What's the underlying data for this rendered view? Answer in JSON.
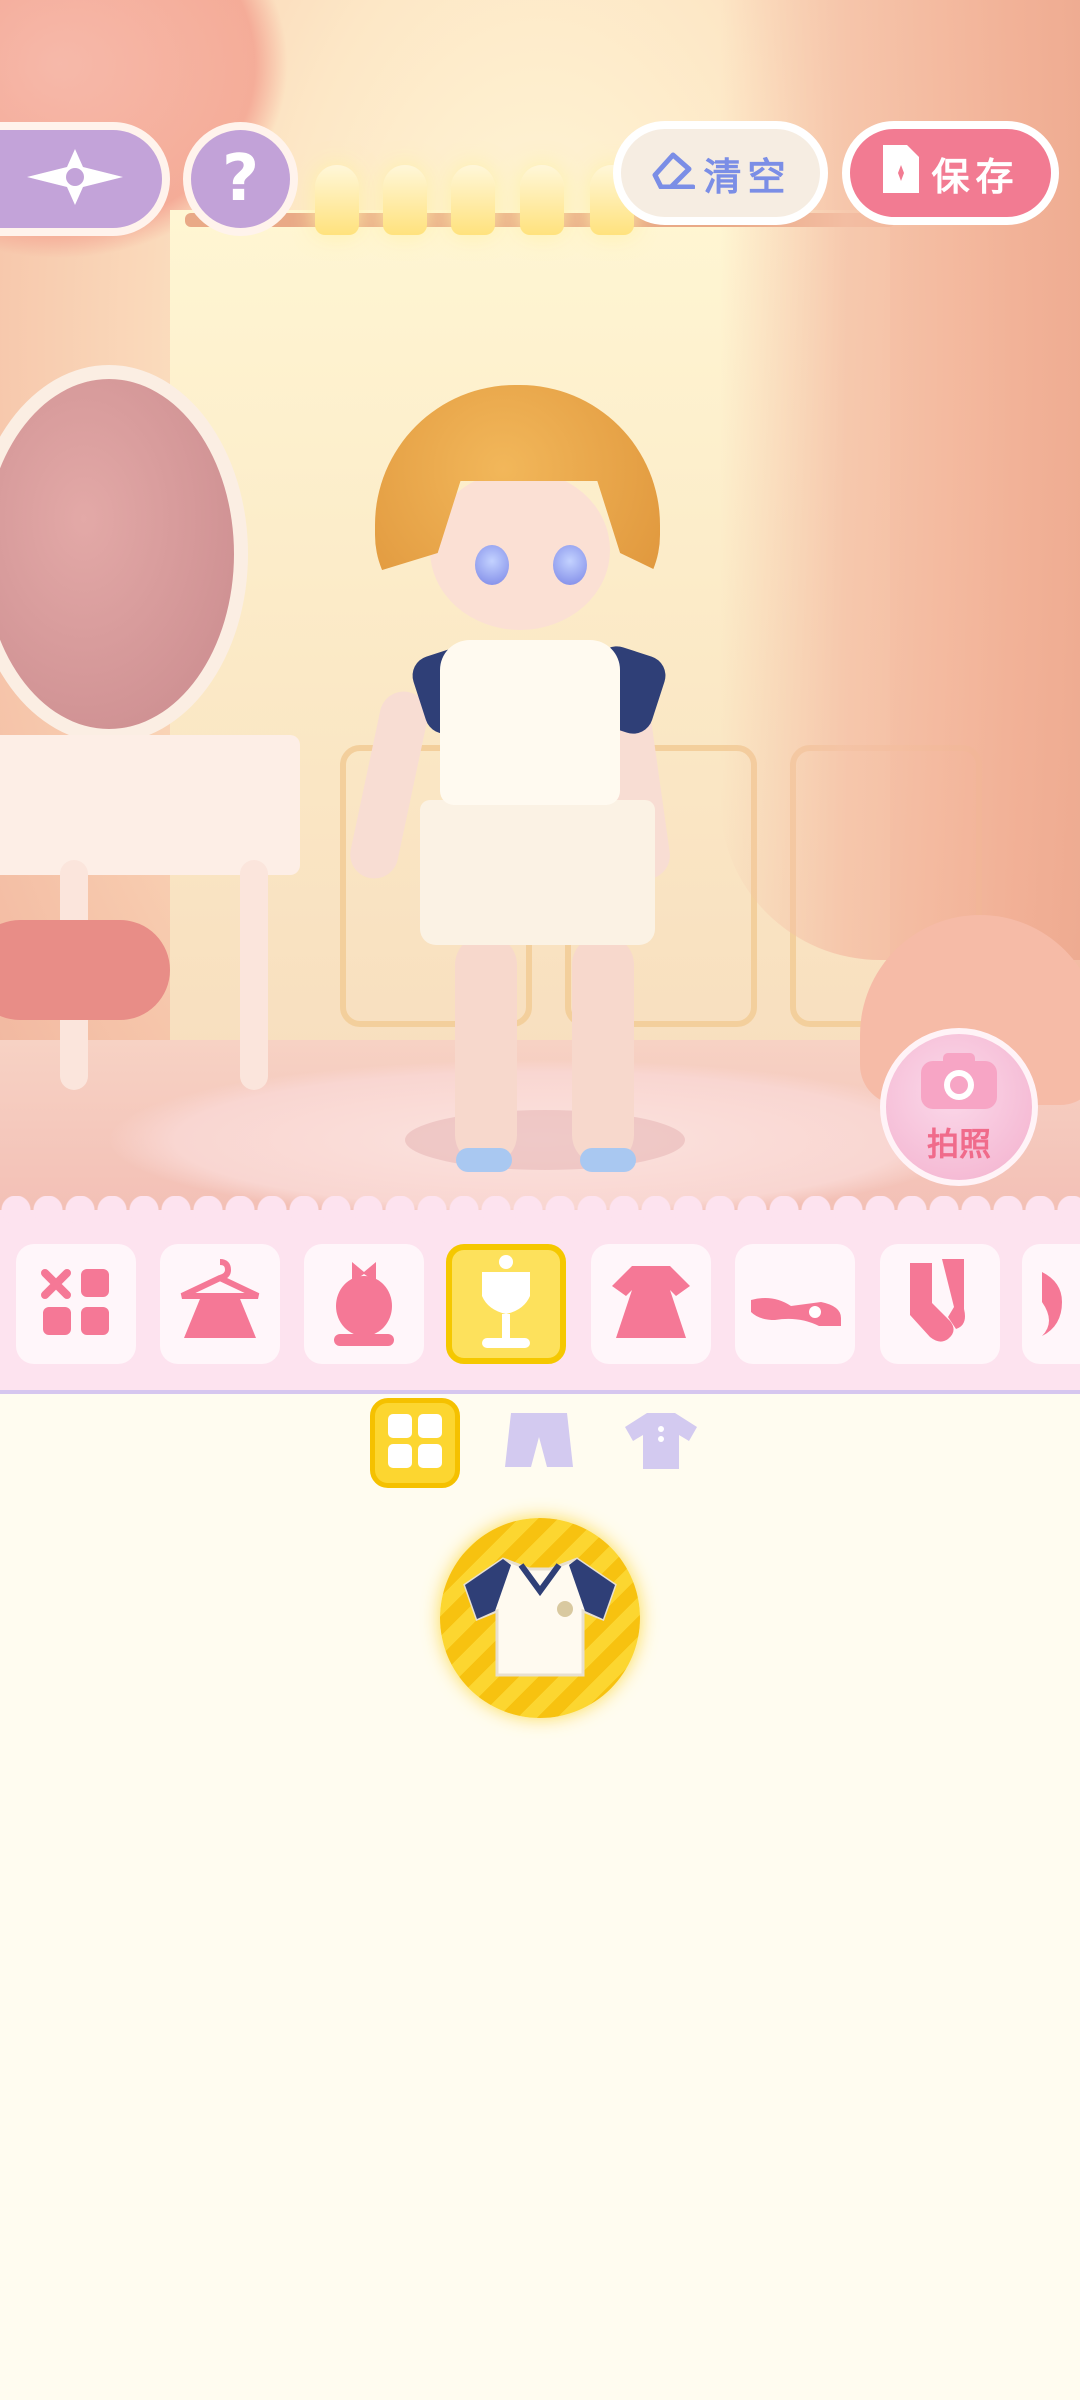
{
  "top_bar": {
    "back_icon": "ornament-back-icon",
    "help_label": "?",
    "clear_label": "清空",
    "save_label": "保存"
  },
  "scene": {
    "photo_label": "拍照"
  },
  "categories": [
    {
      "name": "all",
      "icon": "grid-all-icon",
      "active": false
    },
    {
      "name": "outfit-set",
      "icon": "hanger-dress-icon",
      "active": false
    },
    {
      "name": "hair",
      "icon": "head-bow-icon",
      "active": false
    },
    {
      "name": "tops-bottoms",
      "icon": "mannequin-icon",
      "active": true
    },
    {
      "name": "dress",
      "icon": "dress-icon",
      "active": false
    },
    {
      "name": "shoes",
      "icon": "shoe-icon",
      "active": false
    },
    {
      "name": "socks",
      "icon": "socks-icon",
      "active": false
    }
  ],
  "sub_tabs": [
    {
      "name": "all",
      "icon": "grid-icon",
      "active": true
    },
    {
      "name": "bottoms",
      "icon": "shorts-icon",
      "active": false
    },
    {
      "name": "tops",
      "icon": "shirt-icon",
      "active": false
    }
  ],
  "items": [
    {
      "name": "white-sport-shirt",
      "icon": "shirt-item-icon",
      "selected": true
    }
  ],
  "colors": {
    "accent_yellow": "#fcd630",
    "save_pink": "#f27b92",
    "clear_blue": "#7b8ee6",
    "lavender": "#c3a3d9",
    "category_pink": "#fde3ef"
  }
}
